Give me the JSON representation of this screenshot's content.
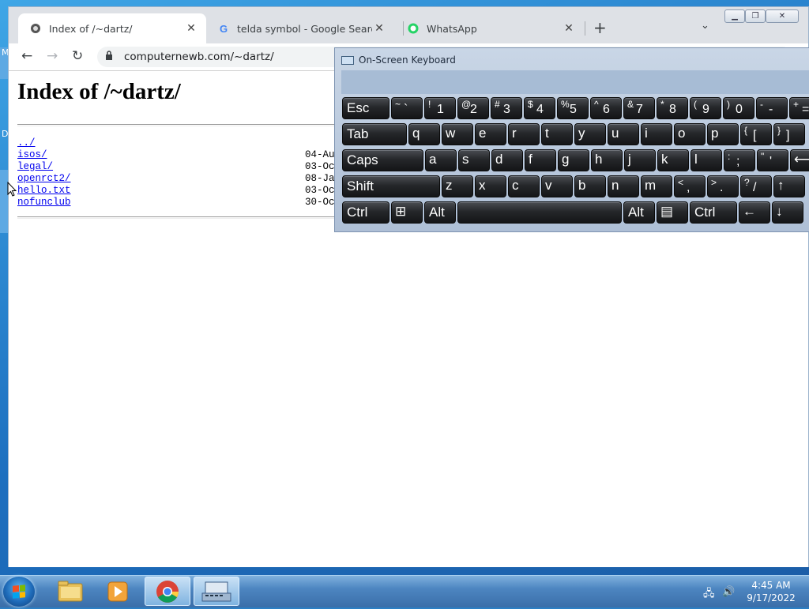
{
  "desktop": {
    "icon_letters": [
      "M",
      "D"
    ]
  },
  "browser": {
    "tabs": [
      {
        "title": "Index of /~dartz/",
        "favicon": "page-icon",
        "active": true
      },
      {
        "title": "telda symbol - Google Search",
        "favicon": "google-icon",
        "active": false
      },
      {
        "title": "WhatsApp",
        "favicon": "whatsapp-icon",
        "active": false
      }
    ],
    "new_tab": "+",
    "url": "computernewb.com/~dartz/"
  },
  "page": {
    "heading": "Index of /~dartz/",
    "entries": [
      {
        "name": "../",
        "date": ""
      },
      {
        "name": "isos/",
        "date": "04-Au"
      },
      {
        "name": "legal/",
        "date": "03-Oc"
      },
      {
        "name": "openrct2/",
        "date": "08-Ja"
      },
      {
        "name": "hello.txt",
        "date": "03-Oc"
      },
      {
        "name": "nofunclub",
        "date": "30-Oc"
      }
    ]
  },
  "osk": {
    "title": "On-Screen Keyboard",
    "rows": [
      [
        {
          "m": "Esc"
        },
        {
          "u": "~",
          "l": "`"
        },
        {
          "u": "!",
          "l": "1"
        },
        {
          "u": "@",
          "l": "2"
        },
        {
          "u": "#",
          "l": "3"
        },
        {
          "u": "$",
          "l": "4"
        },
        {
          "u": "%",
          "l": "5"
        },
        {
          "u": "^",
          "l": "6"
        },
        {
          "u": "&",
          "l": "7"
        },
        {
          "u": "*",
          "l": "8"
        },
        {
          "u": "(",
          "l": "9"
        },
        {
          "u": ")",
          "l": "0"
        },
        {
          "u": "-",
          "l": "-"
        },
        {
          "u": "+",
          "l": "="
        }
      ],
      [
        {
          "m": "Tab"
        },
        {
          "m": "q"
        },
        {
          "m": "w"
        },
        {
          "m": "e"
        },
        {
          "m": "r"
        },
        {
          "m": "t"
        },
        {
          "m": "y"
        },
        {
          "m": "u"
        },
        {
          "m": "i"
        },
        {
          "m": "o"
        },
        {
          "m": "p"
        },
        {
          "u": "{",
          "l": "["
        },
        {
          "u": "}",
          "l": "]"
        }
      ],
      [
        {
          "m": "Caps"
        },
        {
          "m": "a"
        },
        {
          "m": "s"
        },
        {
          "m": "d"
        },
        {
          "m": "f"
        },
        {
          "m": "g"
        },
        {
          "m": "h"
        },
        {
          "m": "j"
        },
        {
          "m": "k"
        },
        {
          "m": "l"
        },
        {
          "u": ":",
          "l": ";"
        },
        {
          "u": "\"",
          "l": "'"
        },
        {
          "m": "⟵"
        }
      ],
      [
        {
          "m": "Shift"
        },
        {
          "m": "z"
        },
        {
          "m": "x"
        },
        {
          "m": "c"
        },
        {
          "m": "v"
        },
        {
          "m": "b"
        },
        {
          "m": "n"
        },
        {
          "m": "m"
        },
        {
          "u": "<",
          "l": ","
        },
        {
          "u": ">",
          "l": "."
        },
        {
          "u": "?",
          "l": "/"
        },
        {
          "m": "↑"
        }
      ],
      [
        {
          "m": "Ctrl"
        },
        {
          "m": "⊞"
        },
        {
          "m": "Alt"
        },
        {
          "m": ""
        },
        {
          "m": "Alt"
        },
        {
          "m": "▤"
        },
        {
          "m": "Ctrl"
        },
        {
          "m": "←"
        },
        {
          "m": "↓"
        }
      ]
    ]
  },
  "taskbar": {
    "apps": [
      "file-explorer-icon",
      "media-player-icon",
      "chrome-icon",
      "on-screen-keyboard-icon"
    ],
    "time": "4:45 AM",
    "date": "9/17/2022"
  }
}
